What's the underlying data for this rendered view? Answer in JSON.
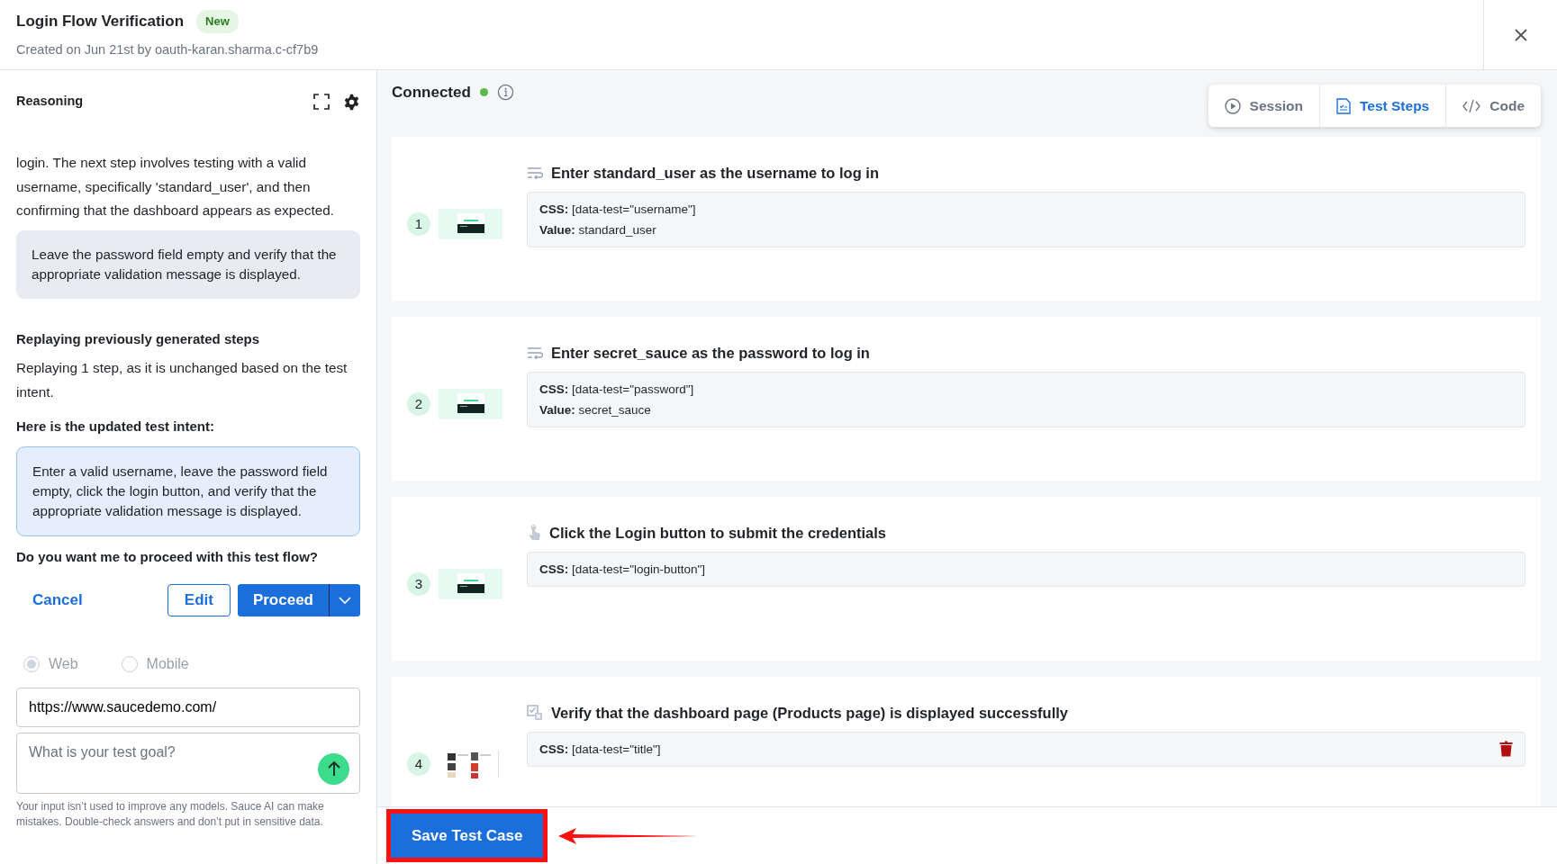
{
  "header": {
    "title": "Login Flow Verification",
    "badge": "New",
    "subtitle": "Created on Jun 21st by oauth-karan.sharma.c-cf7b9"
  },
  "reasoning": {
    "title": "Reasoning",
    "paragraph": "login. The next step involves testing with a valid username, specifically 'standard_user', and then confirming that the dashboard appears as expected.",
    "note": "Leave the password field empty and verify that the appropriate validation message is displayed.",
    "replay_heading": "Replaying previously generated steps",
    "replay_text": "Replaying 1 step, as it is unchanged based on the test intent.",
    "intent_heading": "Here is the updated test intent:",
    "intent": "Enter a valid username, leave the password field empty, click the login button, and verify that the appropriate validation message is displayed.",
    "question": "Do you want me to proceed with this test flow?",
    "buttons": {
      "cancel": "Cancel",
      "edit": "Edit",
      "proceed": "Proceed"
    }
  },
  "platform": {
    "disabled": true,
    "options": [
      {
        "label": "Web",
        "selected": true
      },
      {
        "label": "Mobile",
        "selected": false
      }
    ]
  },
  "url_field": {
    "value": "https://www.saucedemo.com/"
  },
  "goal_field": {
    "placeholder": "What is your test goal?"
  },
  "disclaimer": "Your input isn’t used to improve any models. Sauce AI can make mistakes. Double-check answers and don’t put in sensitive data.",
  "connection": {
    "label": "Connected",
    "connected": true
  },
  "tabs": [
    {
      "label": "Session",
      "kind": "play",
      "selected": false
    },
    {
      "label": "Test Steps",
      "kind": "steps",
      "selected": true
    },
    {
      "label": "Code",
      "kind": "code",
      "selected": false
    }
  ],
  "steps": [
    {
      "number": "1",
      "kind": "input",
      "title": "Enter standard_user as the username to log in",
      "details": [
        "**CSS:** [data-test=\"username\"]",
        "**Value:** standard_user"
      ],
      "deletable": false
    },
    {
      "number": "2",
      "kind": "input",
      "title": "Enter secret_sauce as the password to log in",
      "details": [
        "**CSS:** [data-test=\"password\"]",
        "**Value:** secret_sauce"
      ],
      "deletable": false
    },
    {
      "number": "3",
      "kind": "click",
      "title": "Click the Login button to submit the credentials",
      "details": [
        "**CSS:** [data-test=\"login-button\"]"
      ],
      "deletable": false
    },
    {
      "number": "4",
      "kind": "verify",
      "title": "Verify that the dashboard page (Products page) is displayed successfully",
      "details": [
        "**CSS:** [data-test=\"title\"]"
      ],
      "deletable": true
    }
  ],
  "save_button": "Save Test Case"
}
